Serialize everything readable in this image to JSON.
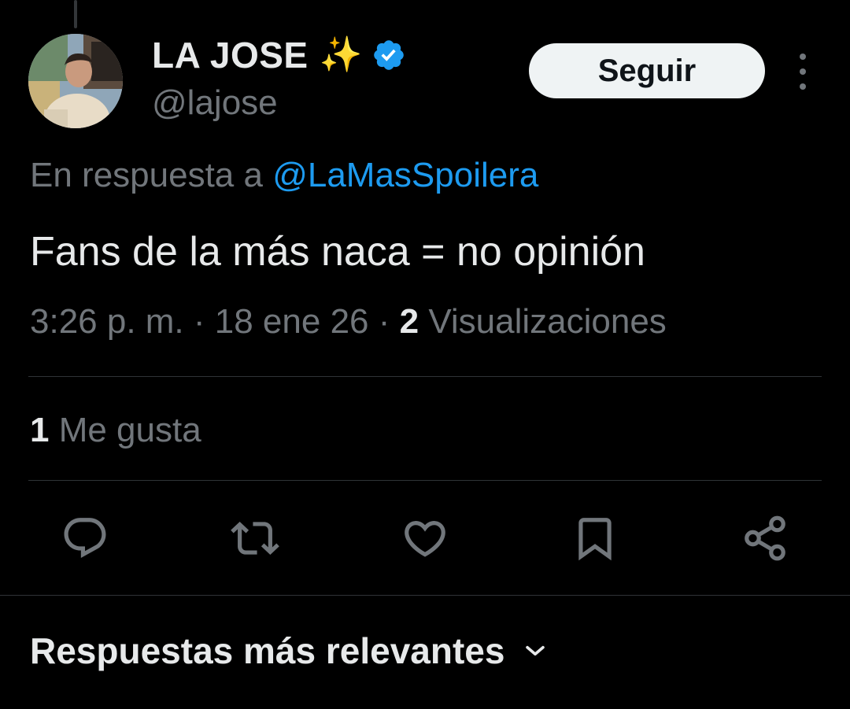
{
  "author": {
    "display_name": "LA JOSE",
    "emoji": "✨",
    "handle": "@lajose",
    "verified_icon": "verified-badge-icon"
  },
  "follow_button": {
    "label": "Seguir"
  },
  "reply_context": {
    "prefix": "En respuesta a",
    "mention": "@LaMasSpoilera"
  },
  "tweet": {
    "text": "Fans de la más naca = no opinión"
  },
  "meta": {
    "time_date": "3:26 p. m. · 18 ene 26 · ",
    "views_count": "2",
    "views_label": " Visualizaciones"
  },
  "likes": {
    "count": "1",
    "label": " Me gusta"
  },
  "actions": [
    {
      "icon": "reply-icon"
    },
    {
      "icon": "retweet-icon"
    },
    {
      "icon": "like-icon"
    },
    {
      "icon": "bookmark-icon"
    },
    {
      "icon": "share-icon"
    }
  ],
  "replies_section": {
    "title": "Respuestas más relevantes"
  },
  "colors": {
    "background": "#000000",
    "text": "#e7e9ea",
    "muted": "#71767b",
    "accent": "#1d9bf0",
    "divider": "#2f3336",
    "button_bg": "#eff3f4"
  }
}
